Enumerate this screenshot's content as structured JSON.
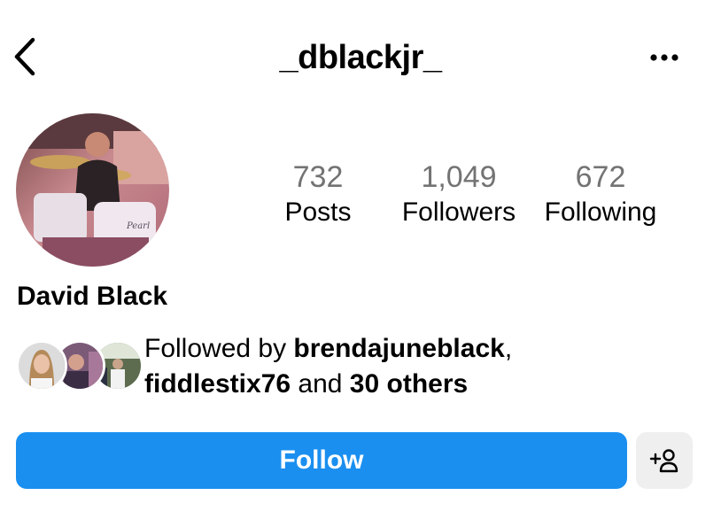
{
  "header": {
    "username": "_dblackjr_",
    "back_icon": "chevron-left-icon",
    "more_icon": "more-horizontal-icon"
  },
  "profile": {
    "display_name": "David Black",
    "avatar_desc": "profile-photo-drummer"
  },
  "stats": [
    {
      "value": "732",
      "label": "Posts"
    },
    {
      "value": "1,049",
      "label": "Followers"
    },
    {
      "value": "672",
      "label": "Following"
    }
  ],
  "followed_by": {
    "prefix": "Followed by ",
    "user1": "brendajuneblack",
    "sep": ",",
    "user2": "fiddlestix76",
    "middle": " and ",
    "others": "30 others"
  },
  "actions": {
    "follow_label": "Follow",
    "suggest_icon": "add-person-icon"
  },
  "colors": {
    "follow_button": "#1a8ff0",
    "stat_number": "#737373",
    "secondary_button": "#efefef"
  }
}
